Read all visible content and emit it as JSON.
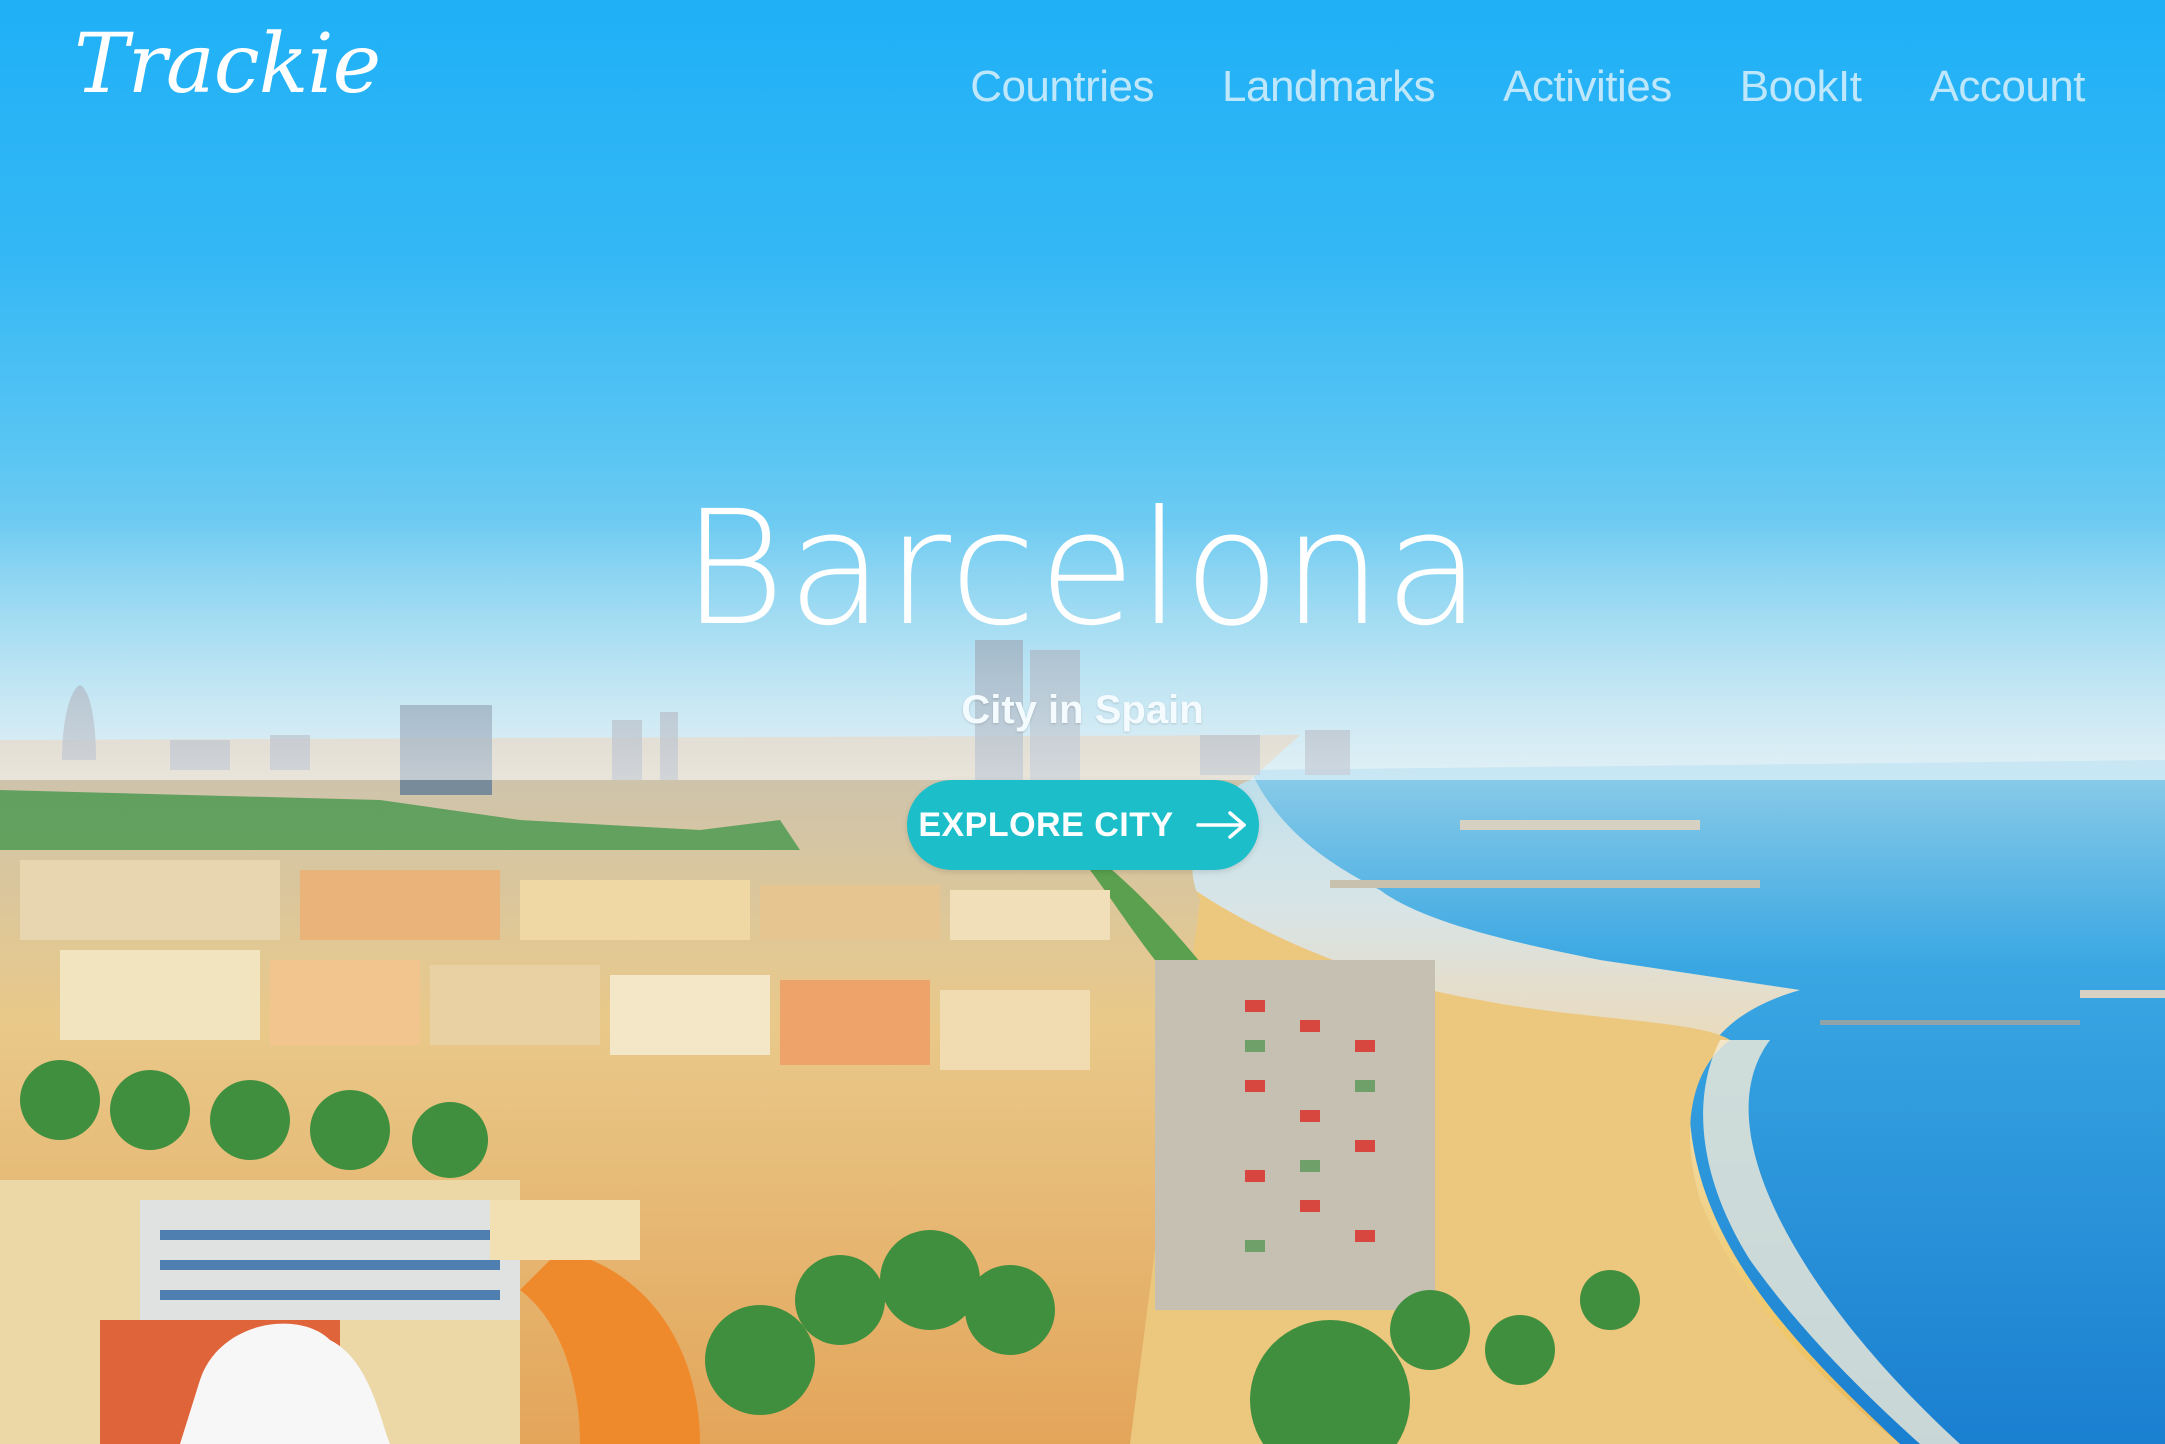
{
  "brand": {
    "logo_text": "Trackie"
  },
  "nav": {
    "items": [
      {
        "label": "Countries"
      },
      {
        "label": "Landmarks"
      },
      {
        "label": "Activities"
      },
      {
        "label": "BookIt"
      },
      {
        "label": "Account"
      }
    ]
  },
  "hero": {
    "title": "Barcelona",
    "subtitle": "City in Spain",
    "cta_label": "EXPLORE CITY",
    "cta_icon": "arrow-right-icon"
  },
  "colors": {
    "sky": "#1fb0f6",
    "cta": "#1cbfc9",
    "nav_text": "#bfe7fb",
    "sea": "#1e8fd9"
  }
}
